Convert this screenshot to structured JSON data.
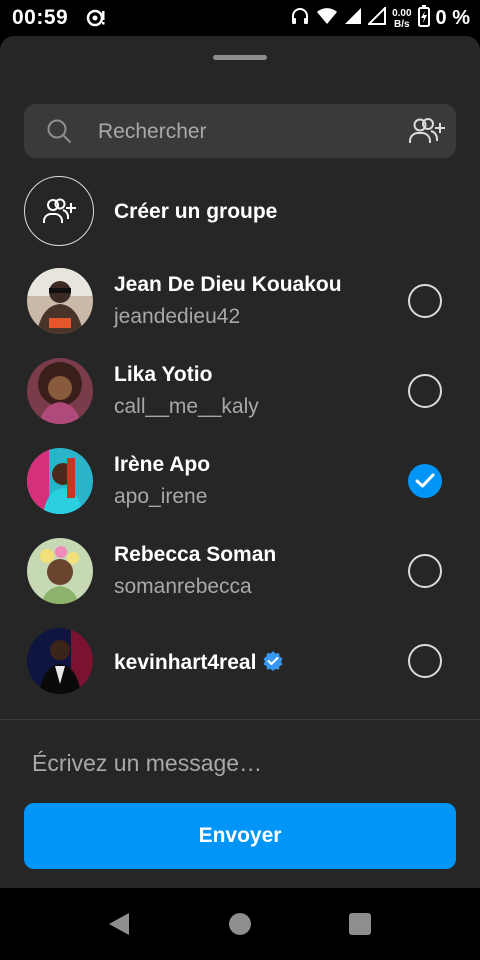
{
  "status_bar": {
    "time": "00:59",
    "net_speed_value": "0.00",
    "net_speed_unit": "B/s",
    "battery": "0 %"
  },
  "search": {
    "placeholder": "Rechercher"
  },
  "create_group": {
    "label": "Créer un groupe"
  },
  "contacts": [
    {
      "name": "Jean De Dieu Kouakou",
      "username": "jeandedieu42",
      "selected": false,
      "verified": false
    },
    {
      "name": "Lika Yotio",
      "username": "call__me__kaly",
      "selected": false,
      "verified": false
    },
    {
      "name": "Irène Apo",
      "username": "apo_irene",
      "selected": true,
      "verified": false
    },
    {
      "name": "Rebecca Soman",
      "username": "somanrebecca",
      "selected": false,
      "verified": false
    },
    {
      "name": "kevinhart4real",
      "username": "",
      "selected": false,
      "verified": true
    }
  ],
  "message": {
    "placeholder": "Écrivez un message…"
  },
  "send_button": {
    "label": "Envoyer"
  },
  "colors": {
    "accent": "#0095f6",
    "sheet": "#262626",
    "search_bg": "#3a3a3a",
    "secondary_text": "#a8a8a8"
  }
}
